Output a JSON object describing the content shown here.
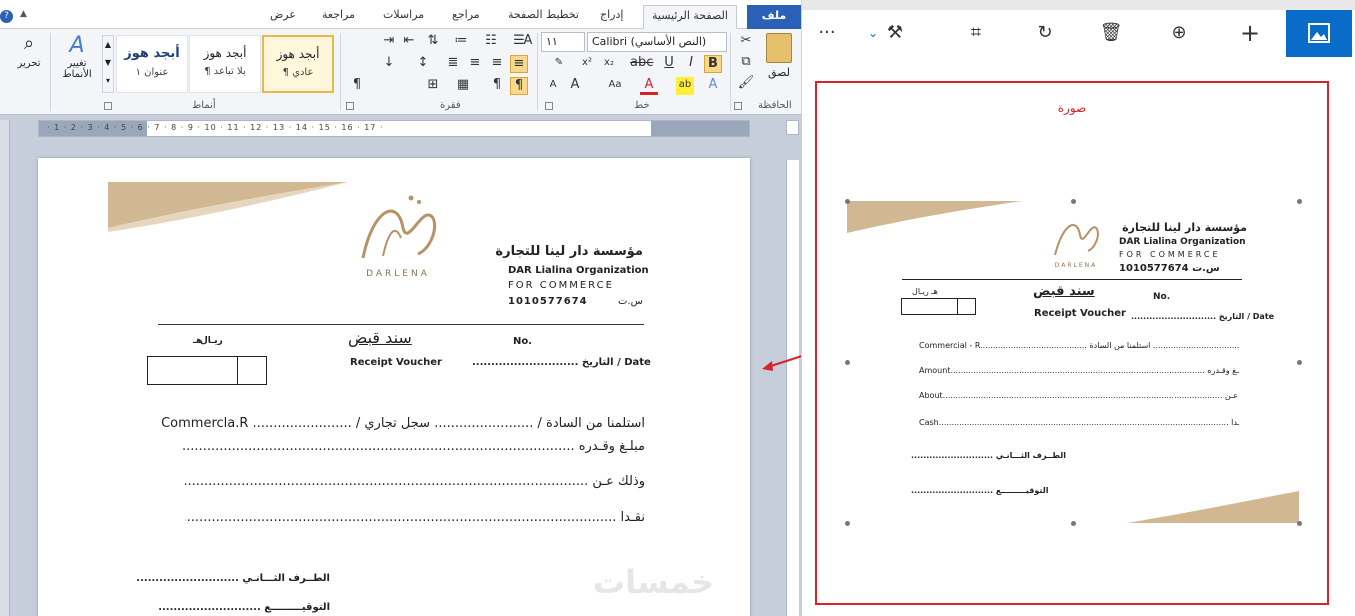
{
  "word": {
    "tabs": {
      "file": "ملف",
      "home": "الصفحة الرئيسية",
      "insert": "إدراج",
      "page_layout": "تخطيط الصفحة",
      "references": "مراجع",
      "mailings": "مراسلات",
      "review": "مراجعة",
      "view": "عرض"
    },
    "ribbon": {
      "groups": {
        "clipboard": "الحافظة",
        "font": "خط",
        "paragraph": "فقرة",
        "styles": "أنماط"
      },
      "paste_label": "لصق",
      "font_name": "Calibri (النص الأساسي)",
      "font_size": "١١",
      "styles": [
        {
          "sample": "أبجد هوز",
          "name": "¶ عادي"
        },
        {
          "sample": "أبجد هوز",
          "name": "¶ بلا تباعد"
        },
        {
          "sample": "أبجد هوز",
          "name": "عنوان ١"
        }
      ],
      "change_styles_label": "تغيير الأنماط",
      "editing_label": "تحرير"
    },
    "ruler": "· 1 · 2 · 3 · 4 · 5 · 6 · 7 · 8 · 9 · 10 · 11 · 12 · 13 · 14 · 15 · 16 · 17 ·",
    "document": {
      "org_ar": "مؤسسة دار لينا للتجارة",
      "org_en": "DAR Lialina Organization",
      "for_commerce": "FOR    COMMERCE",
      "cr_number": "1010577674",
      "cr_label": "س.ت",
      "logo_text": "DARLENA",
      "voucher_title_ar": "سند قبض",
      "voucher_title_en": "Receipt Voucher",
      "no_label": "No.",
      "currency_halala": "هـ",
      "currency_riyal": "ريـال",
      "date_label": "............................ التاريخ / Date",
      "received_from": "استلمنا من السادة / ........................ سجل تجاري / ........................ Commercla.R",
      "amount": "مبلـغ وقـدره ........................................................................................................... Amount",
      "about": "وذلك عـن .............................................................................................................................. About",
      "cash": "نقـداً ...................................................................................................................................... Cash",
      "second_party": "الطــرف الثـــانـي ...........................",
      "signature": "التوقيـــــــــع ..........................."
    },
    "watermark": "خمسات"
  },
  "viewer": {
    "caption": "صورة",
    "toolbar_icons": [
      "more-icon",
      "chevron-down-icon",
      "enhance-icon",
      "crop-icon",
      "rotate-icon",
      "delete-icon",
      "zoom-icon",
      "add-icon",
      "image-icon"
    ],
    "image": {
      "org_ar": "مؤسسة دار لينا للتجارة",
      "org_en": "DAR Lialina Organization",
      "for_commerce": "FOR COMMERCE",
      "cr": "س.ت 1010577674",
      "logo_text": "DARLENA",
      "voucher_ar": "سند قبض",
      "voucher_en": "Receipt Voucher",
      "no": "No.",
      "currency": "هـ            ريـال",
      "date": "............................ التاريخ / Date",
      "received": "Commercial - R.......................................... سجل تجاري/.................................... استلمنا من السادة/",
      "amount": "Amount.................................................................................................... مبلـغ وقـدره",
      "about": "About.............................................................................................................. وذلك عـن",
      "cash": "Cash.................................................................................................................. نقـداً",
      "second_party": "الطــرف الثـــانـي ...........................",
      "signature": "التوقيـــــــــع ..........................."
    }
  },
  "colors": {
    "accent_blue": "#2a61b6",
    "selection_red": "#d4252b",
    "gold": "#c7a77a"
  }
}
